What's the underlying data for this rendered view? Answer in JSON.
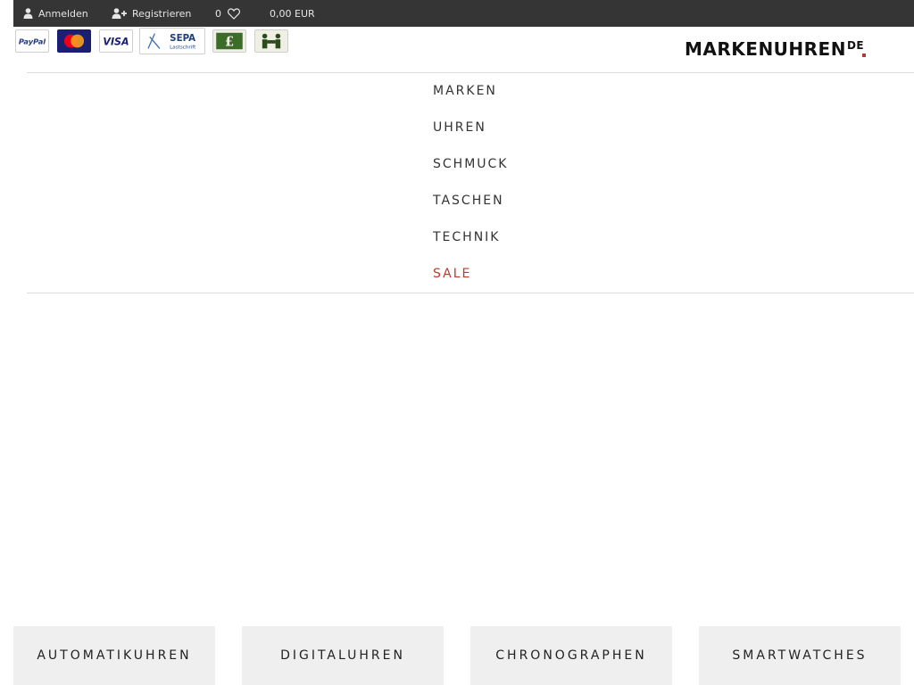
{
  "topbar": {
    "login_label": "Anmelden",
    "register_label": "Registrieren",
    "wishlist_count": "0",
    "cart_total": "0,00 EUR"
  },
  "payments": {
    "paypal_label": "PayPal",
    "visa_label": "VISA",
    "sepa_label": "SEPA",
    "sepa_sub": "Lastschrift"
  },
  "logo": {
    "text": "MARKENUHREN",
    "tld": "DE"
  },
  "menu": {
    "items": [
      "MARKEN",
      "UHREN",
      "SCHMUCK",
      "TASCHEN",
      "TECHNIK",
      "SALE"
    ]
  },
  "tiles": [
    "AUTOMATIKUHREN",
    "DIGITALUHREN",
    "CHRONOGRAPHEN",
    "SMARTWATCHES"
  ],
  "colors": {
    "topbar_bg": "#353535",
    "sale": "#c0392b",
    "tile_bg": "#efefef"
  },
  "icons": {
    "login": "user-icon",
    "register": "user-plus-icon",
    "wishlist": "heart-icon"
  }
}
